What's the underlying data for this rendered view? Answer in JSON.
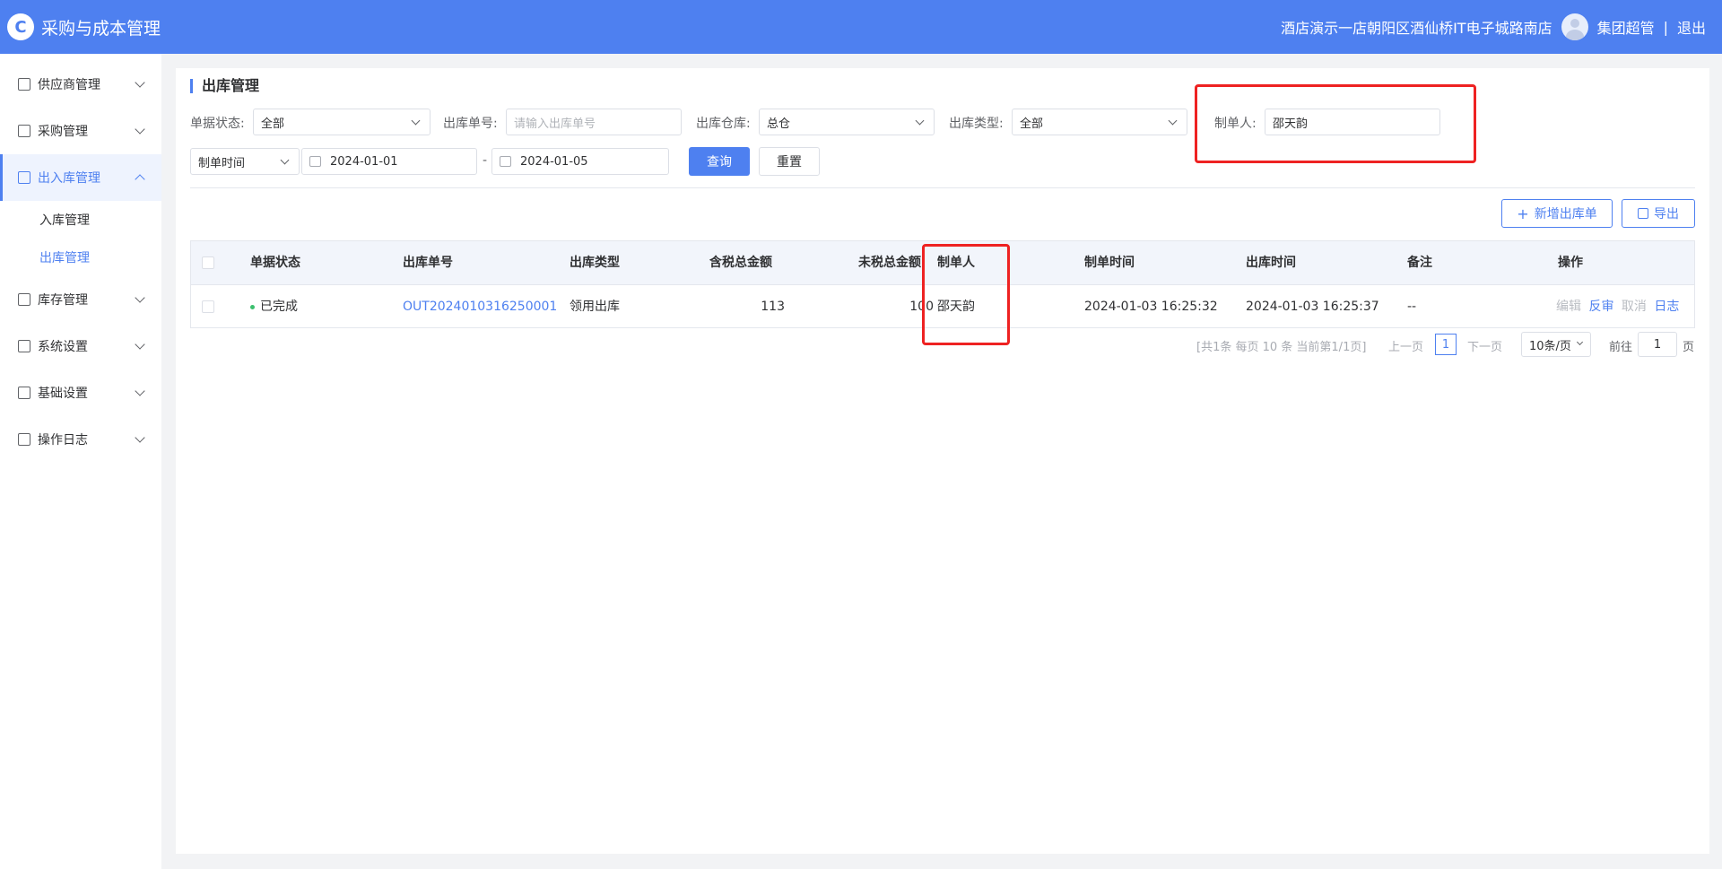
{
  "header": {
    "app_title": "采购与成本管理",
    "store_name": "酒店演示一店朝阳区酒仙桥IT电子城路南店",
    "user_name": "集团超管",
    "separator": "|",
    "logout": "退出"
  },
  "sidebar": {
    "items": [
      {
        "label": "供应商管理",
        "icon": "supplier-icon"
      },
      {
        "label": "采购管理",
        "icon": "purchase-icon"
      },
      {
        "label": "出入库管理",
        "icon": "inout-icon",
        "open": true
      },
      {
        "label": "库存管理",
        "icon": "inventory-icon"
      },
      {
        "label": "系统设置",
        "icon": "system-icon"
      },
      {
        "label": "基础设置",
        "icon": "gear-icon"
      },
      {
        "label": "操作日志",
        "icon": "log-icon"
      }
    ],
    "sub_items": [
      {
        "label": "入库管理"
      },
      {
        "label": "出库管理",
        "active": true
      }
    ]
  },
  "page": {
    "title": "出库管理"
  },
  "filters": {
    "status_label": "单据状态:",
    "status_value": "全部",
    "order_no_label": "出库单号:",
    "order_no_placeholder": "请输入出库单号",
    "warehouse_label": "出库仓库:",
    "warehouse_value": "总仓",
    "type_label": "出库类型:",
    "type_value": "全部",
    "creator_label": "制单人:",
    "creator_value": "邵天韵",
    "date_type_value": "制单时间",
    "date_start": "2024-01-01",
    "date_sep": "-",
    "date_end": "2024-01-05",
    "query_btn": "查询",
    "reset_btn": "重置"
  },
  "actions": {
    "add_btn": "新增出库单",
    "export_btn": "导出"
  },
  "table": {
    "headers": [
      "单据状态",
      "出库单号",
      "出库类型",
      "含税总金额",
      "未税总金额",
      "制单人",
      "制单时间",
      "出库时间",
      "备注",
      "操作"
    ],
    "rows": [
      {
        "status": "已完成",
        "order_no": "OUT202401031625000 1",
        "order_no_display": "OUT202401031625000​1",
        "type": "领用出库",
        "tax_total": "113",
        "untax_total": "100",
        "creator": "邵天韵",
        "created_at": "2024-01-03 16:25:32",
        "out_at": "2024-01-03 16:25:37",
        "remark": "--",
        "ops": [
          "编辑",
          "反审",
          "取消",
          "日志"
        ]
      }
    ]
  },
  "pagination": {
    "summary": "[共1条 每页 10 条 当前第1/1页]",
    "prev": "上一页",
    "current": "1",
    "next": "下一页",
    "page_size": "10条/页",
    "goto_label": "前往",
    "goto_value": "1",
    "page_suffix": "页"
  },
  "colors": {
    "primary": "#4e80f0",
    "highlight": "#ee2222",
    "success": "#3cbf6e"
  }
}
